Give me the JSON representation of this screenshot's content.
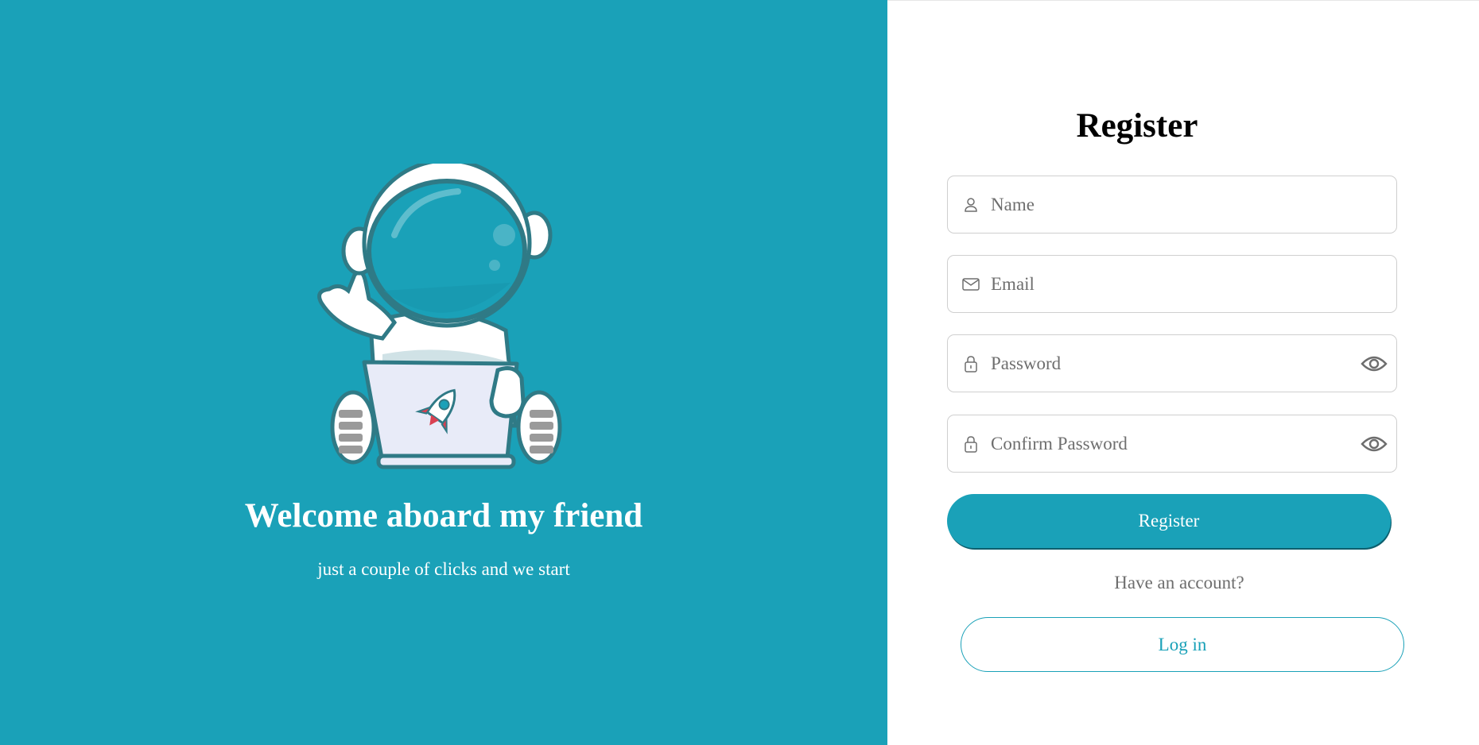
{
  "welcome": {
    "title": "Welcome aboard my friend",
    "subtitle": "just a couple of clicks and we start"
  },
  "form": {
    "title": "Register",
    "fields": {
      "name": {
        "placeholder": "Name",
        "icon": "user-icon"
      },
      "email": {
        "placeholder": "Email",
        "icon": "envelope-icon"
      },
      "password": {
        "placeholder": "Password",
        "icon": "lock-icon",
        "toggle_icon": "eye-icon"
      },
      "confirm_password": {
        "placeholder": "Confirm Password",
        "icon": "lock-icon",
        "toggle_icon": "eye-icon"
      }
    },
    "register_label": "Register",
    "have_account_text": "Have an account?",
    "login_label": "Log in"
  },
  "colors": {
    "accent": "#1aa1b8",
    "panel_text": "#ffffff",
    "placeholder": "#6e6e6e",
    "border": "#cfcfcf"
  }
}
